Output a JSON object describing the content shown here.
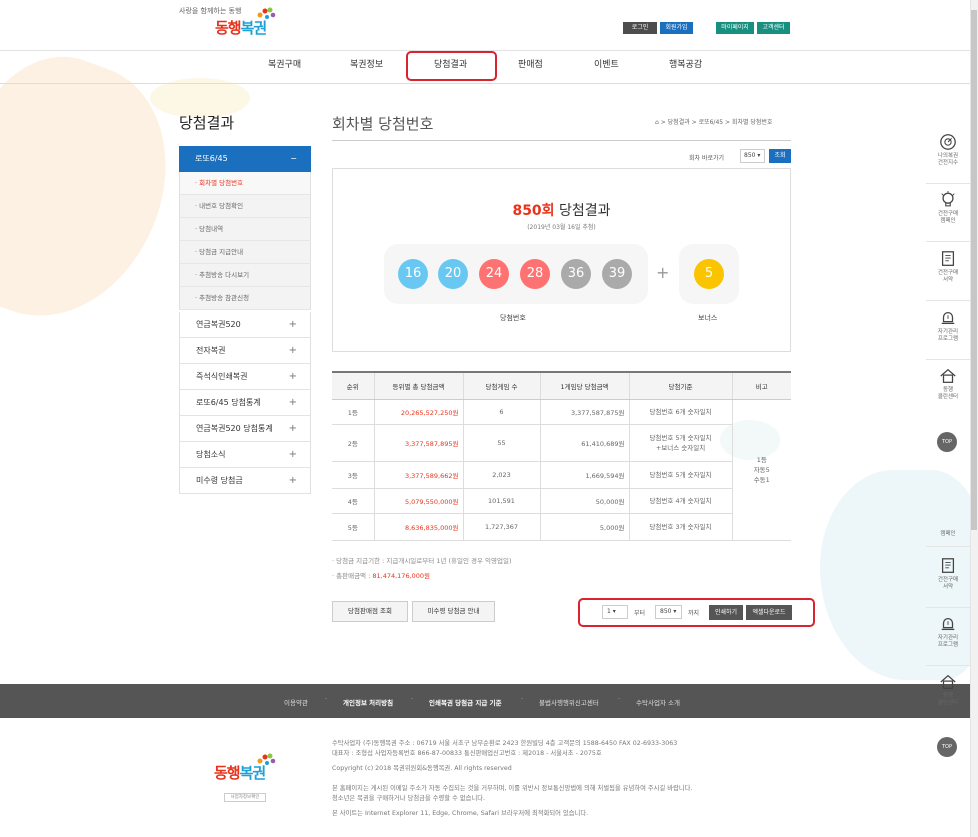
{
  "header": {
    "tagline": "사랑을 함께하는 동행",
    "logo": {
      "part1": "동행",
      "part2": "복권"
    },
    "buttons": [
      {
        "label": "로그인",
        "color": "#4d4d4d"
      },
      {
        "label": "회원가입",
        "color": "#1a6fbf"
      },
      {
        "label": "마이페이지",
        "color": "#17907f"
      },
      {
        "label": "고객센터",
        "color": "#17907f"
      }
    ],
    "nav": [
      "복권구매",
      "복권정보",
      "당첨결과",
      "판매점",
      "이벤트",
      "행복공감"
    ],
    "active_nav": "당첨결과"
  },
  "sidebar": {
    "title": "당첨결과",
    "main": {
      "label": "로또6/45",
      "toggle": "−"
    },
    "sub_items": [
      "회차별 당첨번호",
      "내번호 당첨확인",
      "당첨내역",
      "당첨금 지급안내",
      "추첨방송 다시보기",
      "추첨방송 참관신청"
    ],
    "items": [
      "연금복권520",
      "전자복권",
      "즉석식인쇄복권",
      "로또6/45 당첨통계",
      "연금복권520 당첨통계",
      "당첨소식",
      "미수령 당첨금"
    ],
    "toggle_plus": "+"
  },
  "content": {
    "title": "회차별 당첨번호",
    "breadcrumb": "⌂  >  당첨결과  >  로또6/45  >  회차별 당첨번호",
    "jump": {
      "label": "회차 바로가기",
      "value": "850 ▾",
      "button": "조회"
    },
    "draw": {
      "round": "850회",
      "suffix": " 당첨결과",
      "date": "(2019년 03월 16일 추첨)"
    },
    "numbers": [
      {
        "n": "16",
        "color": "#69c8f2"
      },
      {
        "n": "20",
        "color": "#69c8f2"
      },
      {
        "n": "24",
        "color": "#ff7272"
      },
      {
        "n": "28",
        "color": "#ff7272"
      },
      {
        "n": "36",
        "color": "#aaaaaa"
      },
      {
        "n": "39",
        "color": "#aaaaaa"
      }
    ],
    "plus": "+",
    "bonus": {
      "n": "5",
      "color": "#fbc400"
    },
    "win_label": "당첨번호",
    "bonus_label": "보너스",
    "table": {
      "headers": [
        "순위",
        "등위별 총 당첨금액",
        "당첨게임 수",
        "1게임당 당첨금액",
        "당첨기준",
        "비고"
      ],
      "rows": [
        {
          "rank": "1등",
          "total": "20,265,527,250원",
          "games": "6",
          "per": "3,377,587,875원",
          "rule": "당첨번호 6개 숫자일치"
        },
        {
          "rank": "2등",
          "total": "3,377,587,895원",
          "games": "55",
          "per": "61,410,689원",
          "rule": "당첨번호 5개 숫자일치\n+보너스 숫자일치"
        },
        {
          "rank": "3등",
          "total": "3,377,589,662원",
          "games": "2,023",
          "per": "1,669,594원",
          "rule": "당첨번호 5개 숫자일치"
        },
        {
          "rank": "4등",
          "total": "5,079,550,000원",
          "games": "101,591",
          "per": "50,000원",
          "rule": "당첨번호 4개 숫자일치"
        },
        {
          "rank": "5등",
          "total": "8,636,835,000원",
          "games": "1,727,367",
          "per": "5,000원",
          "rule": "당첨번호 3개 숫자일치"
        }
      ],
      "remark": "1등\n자동5\n수동1"
    },
    "notes": {
      "line1": "· 당첨금 지급기한 : 지급개시일로부터 1년 (휴일인 경우 익영업일)",
      "line2_label": "· 총판매금액 : ",
      "line2_value": "81,474,176,000원"
    },
    "buttons": {
      "store": "당첨판매점 조회",
      "unclaimed": "미수령 당첨금 안내"
    },
    "download": {
      "from": "1",
      "from_label": "부터",
      "to": "850",
      "to_label": "까지",
      "print": "인쇄하기",
      "excel": "엑셀다운로드"
    }
  },
  "footer": {
    "links": [
      "이용약관",
      "개인정보 처리방침",
      "인쇄복권 당첨금 지급 기준",
      "불법사행행위신고센터",
      "수탁사업자 소개"
    ],
    "sep": "·",
    "logo_badge": "사업자정보확인",
    "lines": [
      "수탁사업자 (주)동행복권    주소 : 06719 서울 서초구 남부순환로 2423 한원빌딩 4층    고객문의 1588-6450    FAX 02-6933-3063",
      "대표자 : 조형섭    사업자등록번호 866-87-00833    통신판매업신고번호 : 제2018 - 서울서초 - 2075호",
      "Copyright (c) 2018 복권위원회&동행복권. All rights reserved",
      "본 홈페이지는 게시된 이메일 주소가 자동 수집되는 것을 거부하며, 이를 위반시 정보통신망법에 의해 처벌됨을 유념하여 주시길 바랍니다.",
      "청소년은 복권을 구매하거나 당첨금을 수령할 수 없습니다.",
      "본 사이트는 Internet Explorer 11, Edge, Chrome, Safari 브라우저에 최적화되어 있습니다."
    ]
  },
  "quick_menu": {
    "items": [
      "나의복권\n건전지수",
      "건전구매\n캠페인",
      "건전구매\n서약",
      "자기관리\n프로그램",
      "동행\n클린센터"
    ],
    "lower_items": [
      "캠페인",
      "건전구매\n서약",
      "자기관리\n프로그램",
      "동행\n클린센터"
    ],
    "top": "TOP"
  }
}
